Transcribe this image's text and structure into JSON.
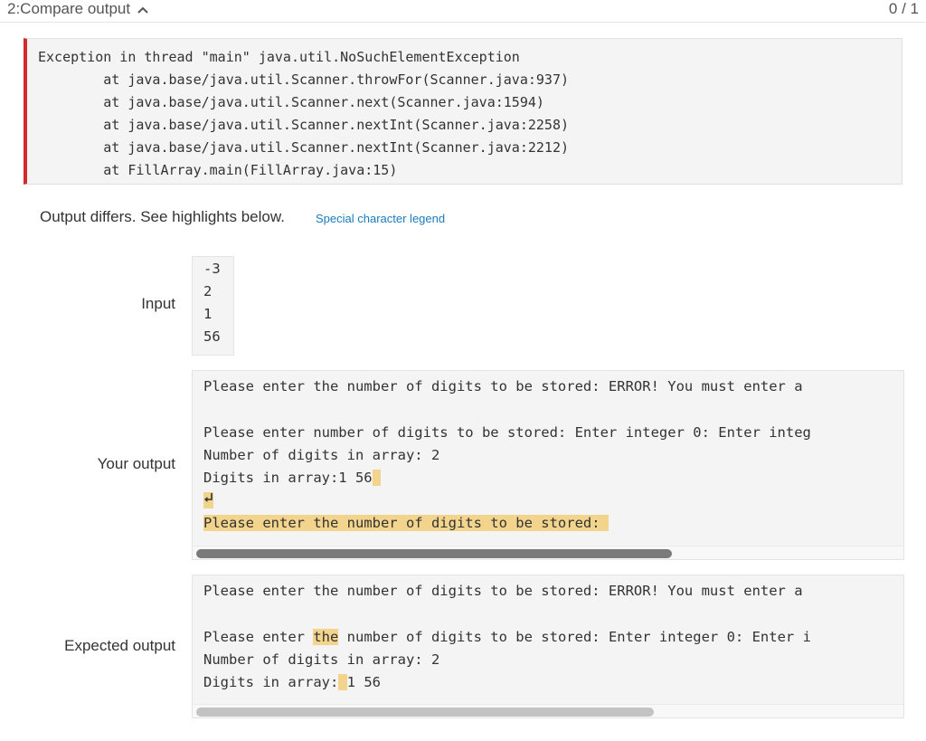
{
  "header": {
    "title": "2:Compare output",
    "score": "0 / 1"
  },
  "exception": {
    "lines": [
      "Exception in thread \"main\" java.util.NoSuchElementException",
      "        at java.base/java.util.Scanner.throwFor(Scanner.java:937)",
      "        at java.base/java.util.Scanner.next(Scanner.java:1594)",
      "        at java.base/java.util.Scanner.nextInt(Scanner.java:2258)",
      "        at java.base/java.util.Scanner.nextInt(Scanner.java:2212)",
      "        at FillArray.main(FillArray.java:15)"
    ]
  },
  "status": {
    "message": "Output differs. See highlights below.",
    "legend_link": "Special character legend"
  },
  "input": {
    "label": "Input",
    "lines": [
      "-3",
      "2",
      "1",
      "56"
    ]
  },
  "your_output": {
    "label": "Your output",
    "line1": "Please enter the number of digits to be stored: ERROR! You must enter a",
    "line3": "Please enter number of digits to be stored: Enter integer 0: Enter integ",
    "line4": "Number of digits in array: 2",
    "line5_text": "Digits in array:1 56",
    "line7_highlight": "Please enter the number of digits to be stored: "
  },
  "expected_output": {
    "label": "Expected output",
    "line1": "Please enter the number of digits to be stored: ERROR! You must enter a",
    "line3_before": "Please enter ",
    "line3_hl": "the",
    "line3_after": " number of digits to be stored: Enter integer 0: Enter i",
    "line4": "Number of digits in array: 2",
    "line5_before": "Digits in array:",
    "line5_after": "1 56"
  },
  "colors": {
    "highlight": "#f3d48c",
    "error_border": "#d42a2a",
    "link": "#1a7bbd"
  }
}
